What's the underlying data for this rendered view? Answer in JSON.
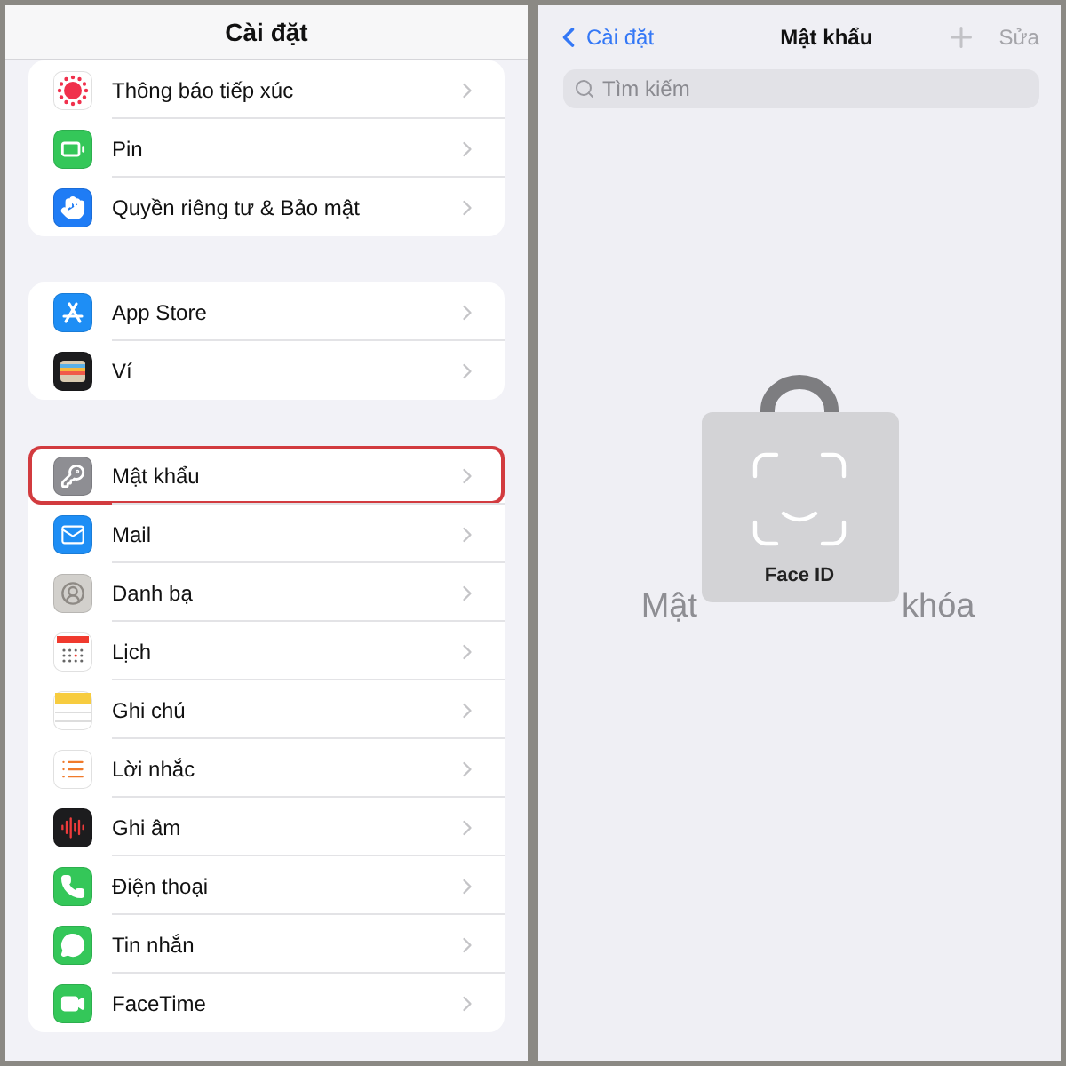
{
  "settings": {
    "title": "Cài đặt",
    "groups": [
      {
        "items": [
          {
            "label": "Thông báo tiếp xúc",
            "kind": "exposure",
            "highlighted": false
          },
          {
            "label": "Pin",
            "kind": "battery",
            "highlighted": false
          },
          {
            "label": "Quyền riêng tư & Bảo mật",
            "kind": "hand",
            "highlighted": false
          }
        ]
      },
      {
        "items": [
          {
            "label": "App Store",
            "kind": "appstore",
            "highlighted": false
          },
          {
            "label": "Ví",
            "kind": "wallet",
            "highlighted": false
          }
        ]
      },
      {
        "items": [
          {
            "label": "Mật khẩu",
            "kind": "key",
            "highlighted": true
          },
          {
            "label": "Mail",
            "kind": "mail",
            "highlighted": false
          },
          {
            "label": "Danh bạ",
            "kind": "contacts",
            "highlighted": false
          },
          {
            "label": "Lịch",
            "kind": "calendar",
            "highlighted": false
          },
          {
            "label": "Ghi chú",
            "kind": "notes",
            "highlighted": false
          },
          {
            "label": "Lời nhắc",
            "kind": "reminders",
            "highlighted": false
          },
          {
            "label": "Ghi âm",
            "kind": "voice",
            "highlighted": false
          },
          {
            "label": "Điện thoại",
            "kind": "phone",
            "highlighted": false
          },
          {
            "label": "Tin nhắn",
            "kind": "messages",
            "highlighted": false
          },
          {
            "label": "FaceTime",
            "kind": "facetime",
            "highlighted": false
          }
        ]
      }
    ]
  },
  "passwords": {
    "back": "Cài đặt",
    "title": "Mật khẩu",
    "edit": "Sửa",
    "search": {
      "placeholder": "Tìm kiếm"
    },
    "locked_message_parts": [
      "Mật",
      "khóa"
    ],
    "face_id": {
      "label": "Face ID"
    }
  }
}
